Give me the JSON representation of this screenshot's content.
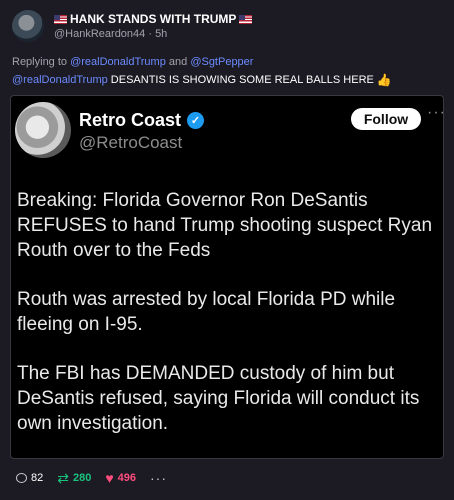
{
  "author": {
    "display_name": "HANK STANDS WITH TRUMP",
    "handle": "@HankReardon44",
    "separator": " · ",
    "time": "5h"
  },
  "reply": {
    "prefix": "Replying to ",
    "mention1": "@realDonaldTrump",
    "and": " and ",
    "mention2": "@SgtPepper"
  },
  "post": {
    "mention": "@realDonaldTrump",
    "text": " DESANTIS IS SHOWING SOME REAL BALLS HERE"
  },
  "embed": {
    "name": "Retro Coast",
    "handle": "@RetroCoast",
    "follow_label": "Follow",
    "paragraphs": [
      "Breaking: Florida Governor Ron DeSantis REFUSES to hand Trump shooting suspect Ryan Routh over to the Feds",
      "Routh was arrested by local Florida PD while fleeing on I-95.",
      "The FBI has DEMANDED custody of him but DeSantis refused, saying Florida will conduct its own investigation."
    ]
  },
  "actions": {
    "comments": "82",
    "reposts": "280",
    "likes": "496"
  },
  "icons": [
    "flag-icon",
    "verified-icon",
    "comment-icon",
    "repost-icon",
    "heart-icon",
    "more-icon",
    "thumbs-up-icon"
  ],
  "colors": {
    "background": "#1c1a23",
    "mention": "#6c8cff",
    "repost": "#19c37d",
    "like": "#ff4d7e",
    "verified": "#1d9bf0"
  }
}
